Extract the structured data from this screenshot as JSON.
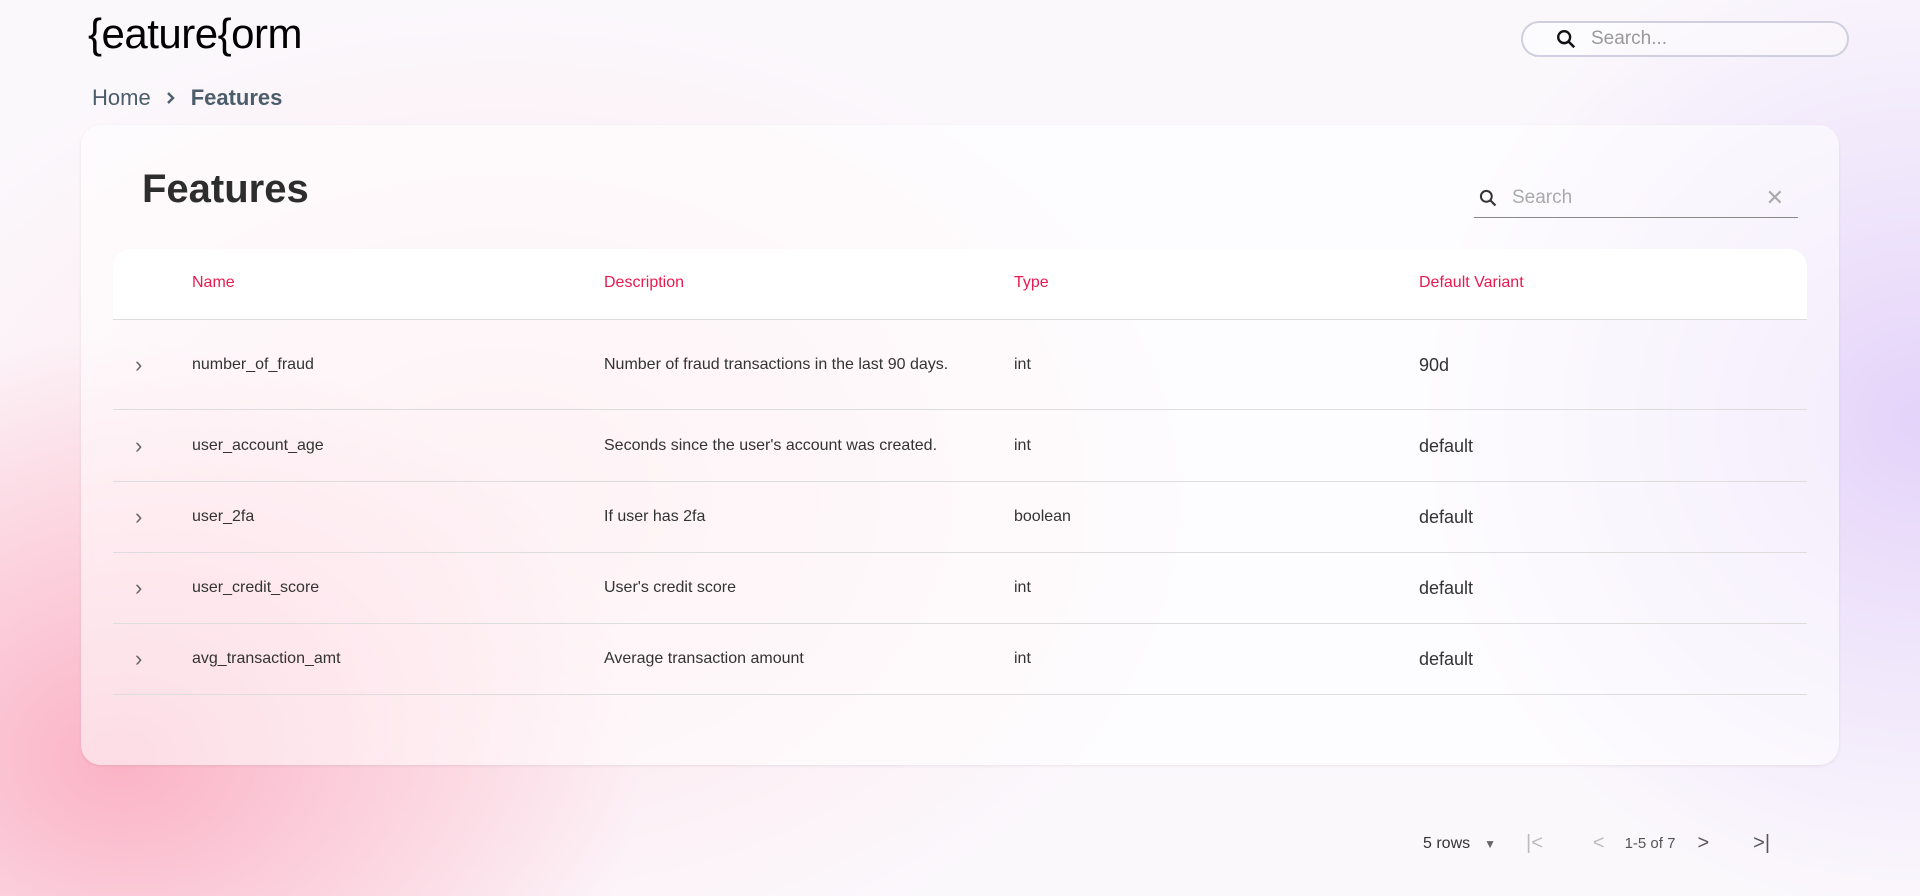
{
  "header": {
    "logo": "{eature{orm",
    "search_placeholder": "Search..."
  },
  "breadcrumb": {
    "home": "Home",
    "current": "Features"
  },
  "main": {
    "title": "Features",
    "search_placeholder": "Search",
    "columns": [
      "Name",
      "Description",
      "Type",
      "Default Variant"
    ],
    "rows": [
      {
        "name": "number_of_fraud",
        "description": "Number of fraud transactions in the last 90 days.",
        "type": "int",
        "default_variant": "90d"
      },
      {
        "name": "user_account_age",
        "description": "Seconds since the user's account was created.",
        "type": "int",
        "default_variant": "default"
      },
      {
        "name": "user_2fa",
        "description": "If user has 2fa",
        "type": "boolean",
        "default_variant": "default"
      },
      {
        "name": "user_credit_score",
        "description": "User's credit score",
        "type": "int",
        "default_variant": "default"
      },
      {
        "name": "avg_transaction_amt",
        "description": "Average transaction amount",
        "type": "int",
        "default_variant": "default"
      }
    ],
    "pagination": {
      "rows_per_page": "5 rows",
      "range": "1-5 of 7"
    }
  },
  "colors": {
    "accent": "#e8194f"
  }
}
